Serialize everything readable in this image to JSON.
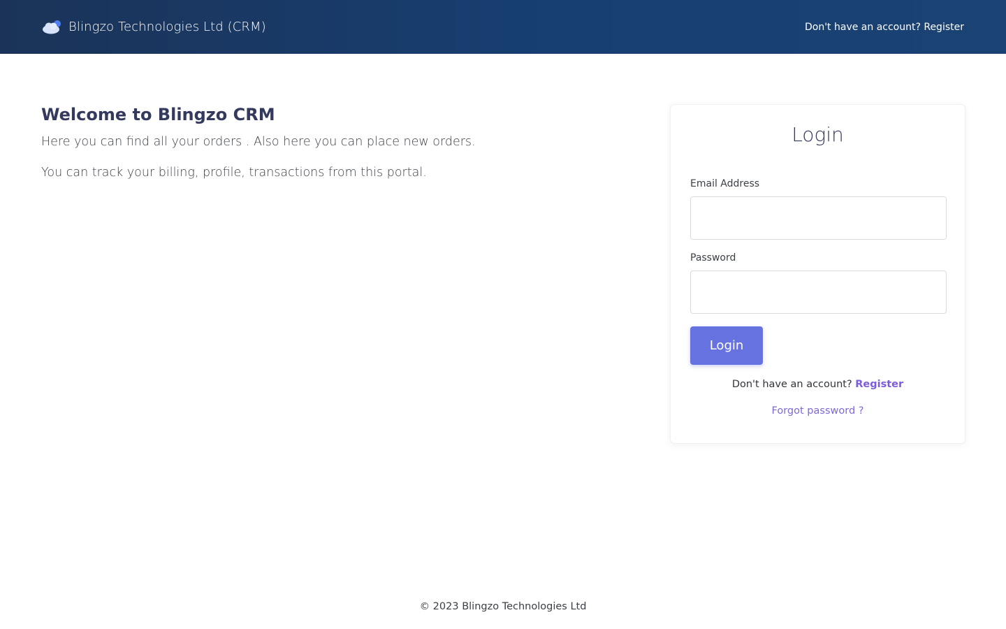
{
  "header": {
    "logo_icon": "cloud-icon",
    "brand_name": "Blingzo Technologies Ltd (CRM)",
    "register_link": "Don't have an account? Register"
  },
  "intro": {
    "heading": "Welcome to Blingzo CRM",
    "line1": "Here you can find all your orders . Also here you can place new orders.",
    "line2": "You can track your billing, profile, transactions from this portal."
  },
  "login": {
    "title": "Login",
    "email_label": "Email Address",
    "email_value": "",
    "password_label": "Password",
    "password_value": "",
    "button_label": "Login",
    "register_prompt": "Don't have an account?",
    "register_label": "Register",
    "forgot_label": "Forgot password ?"
  },
  "footer": {
    "copyright": "© 2023 Blingzo Technologies Ltd"
  },
  "colors": {
    "header_bg": "#1a3a66",
    "accent": "#6672e0",
    "link": "#7c5be0",
    "heading": "#343a5e"
  }
}
